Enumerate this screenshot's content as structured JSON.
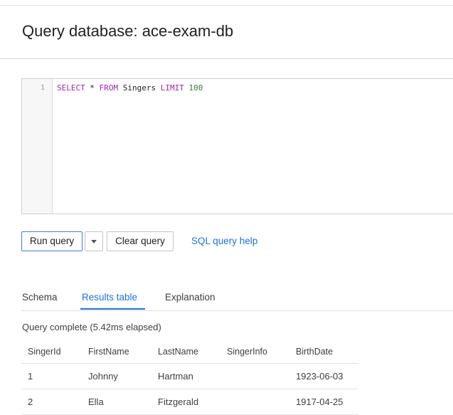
{
  "page": {
    "title": "Query database: ace-exam-db"
  },
  "editor": {
    "line_number": "1",
    "tokens": {
      "select": "SELECT",
      "star": "*",
      "from": "FROM",
      "table": "Singers",
      "limit": "LIMIT",
      "count": "100"
    }
  },
  "actions": {
    "run_query": "Run query",
    "clear_query": "Clear query",
    "help_link": "SQL query help",
    "dropdown_icon": "caret-down-icon"
  },
  "tabs": [
    {
      "label": "Schema",
      "active": false
    },
    {
      "label": "Results table",
      "active": true
    },
    {
      "label": "Explanation",
      "active": false
    }
  ],
  "status": "Query complete (5.42ms elapsed)",
  "results": {
    "columns": [
      "SingerId",
      "FirstName",
      "LastName",
      "SingerInfo",
      "BirthDate"
    ],
    "rows": [
      [
        "1",
        "Johnny",
        "Hartman",
        "",
        "1923-06-03"
      ],
      [
        "2",
        "Ella",
        "Fitzgerald",
        "",
        "1917-04-25"
      ]
    ]
  },
  "colors": {
    "accent": "#1a73e8",
    "keyword": "#9c27b0",
    "number": "#2e7d32"
  }
}
